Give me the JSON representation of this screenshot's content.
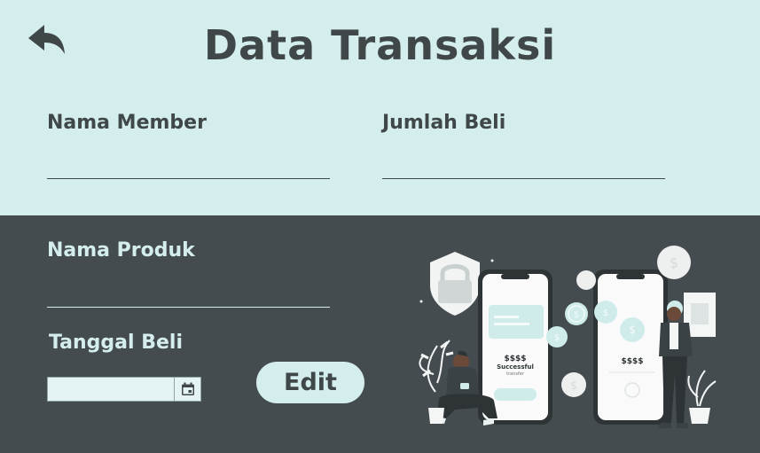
{
  "header": {
    "title": "Data Transaksi"
  },
  "fields": {
    "nama_member": {
      "label": "Nama Member",
      "value": ""
    },
    "jumlah_beli": {
      "label": "Jumlah Beli",
      "value": ""
    },
    "nama_produk": {
      "label": "Nama Produk",
      "value": ""
    },
    "tanggal_beli": {
      "label": "Tanggal Beli",
      "value": ""
    }
  },
  "actions": {
    "edit_label": "Edit"
  },
  "illustration": {
    "phone_left": {
      "amount": "$$$$",
      "status": "Successful",
      "sub": "transfer"
    },
    "phone_right": {
      "amount": "$$$$"
    },
    "icons": [
      "back-arrow-icon",
      "calendar-icon",
      "padlock-icon",
      "dollar-coin-icon"
    ]
  },
  "colors": {
    "light": "#d4eeee",
    "dark": "#454c4f",
    "text_dark": "#404749"
  }
}
